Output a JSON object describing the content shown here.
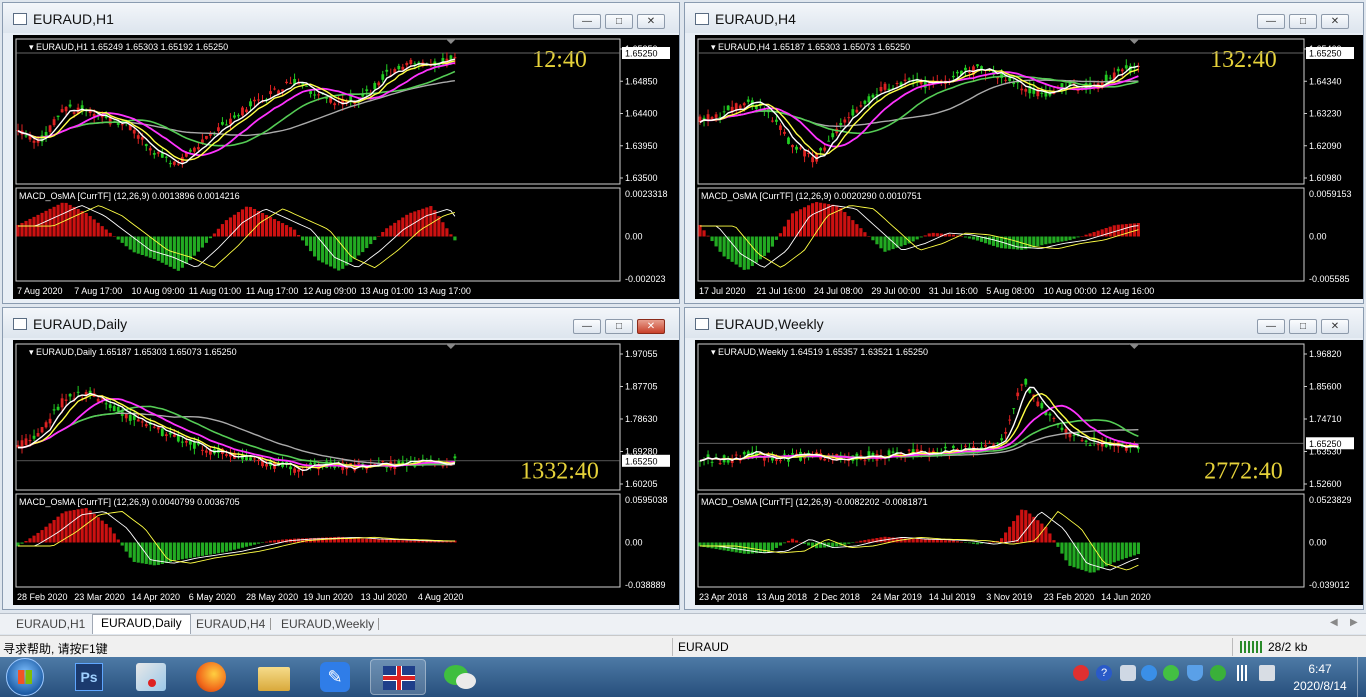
{
  "windows": [
    {
      "title": "EURAUD,H1",
      "info": "EURAUD,H1  1.65249 1.65303 1.65192 1.65250",
      "timer": "12:40",
      "price_ticks": [
        "1.65250",
        "1.64850",
        "1.64400",
        "1.63950",
        "1.63500"
      ],
      "price_current": "1.65250",
      "macd_label": "MACD_OsMA [CurrTF] (12,26,9) 0.0013896 0.0014216",
      "macd_ticks": [
        "0.0023318",
        "0.00",
        "-0.002023"
      ],
      "time_ticks": [
        "7 Aug 2020",
        "7 Aug 17:00",
        "10 Aug 09:00",
        "11 Aug 01:00",
        "11 Aug 17:00",
        "12 Aug 09:00",
        "13 Aug 01:00",
        "13 Aug 17:00"
      ],
      "close_style": "normal"
    },
    {
      "title": "EURAUD,H4",
      "info": "EURAUD,H4  1.65187 1.65303 1.65073 1.65250",
      "timer": "132:40",
      "price_ticks": [
        "1.65460",
        "1.64340",
        "1.63230",
        "1.62090",
        "1.60980"
      ],
      "price_current": "1.65250",
      "macd_label": "MACD_OsMA [CurrTF] (12,26,9) 0.0020290 0.0010751",
      "macd_ticks": [
        "0.0059153",
        "0.00",
        "-0.005585"
      ],
      "time_ticks": [
        "17 Jul 2020",
        "21 Jul 16:00",
        "24 Jul 08:00",
        "29 Jul 00:00",
        "31 Jul 16:00",
        "5 Aug 08:00",
        "10 Aug 00:00",
        "12 Aug 16:00"
      ],
      "close_style": "normal"
    },
    {
      "title": "EURAUD,Daily",
      "info": "EURAUD,Daily  1.65187 1.65303 1.65073 1.65250",
      "timer": "1332:40",
      "price_ticks": [
        "1.97055",
        "1.87705",
        "1.78630",
        "1.69280",
        "1.60205"
      ],
      "price_current": "1.65250",
      "macd_label": "MACD_OsMA [CurrTF] (12,26,9) 0.0040799 0.0036705",
      "macd_ticks": [
        "0.0595038",
        "0.00",
        "-0.038889"
      ],
      "time_ticks": [
        "28 Feb 2020",
        "23 Mar 2020",
        "14 Apr 2020",
        "6 May 2020",
        "28 May 2020",
        "19 Jun 2020",
        "13 Jul 2020",
        "4 Aug 2020"
      ],
      "close_style": "red"
    },
    {
      "title": "EURAUD,Weekly",
      "info": "EURAUD,Weekly  1.64519 1.65357 1.63521 1.65250",
      "timer": "2772:40",
      "price_ticks": [
        "1.96820",
        "1.85600",
        "1.74710",
        "1.63530",
        "1.52600"
      ],
      "price_current": "1.65250",
      "macd_label": "MACD_OsMA [CurrTF] (12,26,9) -0.0082202 -0.0081871",
      "macd_ticks": [
        "0.0523829",
        "0.00",
        "-0.039012"
      ],
      "time_ticks": [
        "23 Apr 2018",
        "13 Aug 2018",
        "2 Dec 2018",
        "24 Mar 2019",
        "14 Jul 2019",
        "3 Nov 2019",
        "23 Feb 2020",
        "14 Jun 2020"
      ],
      "close_style": "normal"
    }
  ],
  "tabs": [
    "EURAUD,H1",
    "EURAUD,Daily",
    "EURAUD,H4",
    "EURAUD,Weekly"
  ],
  "active_tab": "EURAUD,Daily",
  "status": {
    "help": "寻求帮助, 请按F1键",
    "symbol": "EURAUD",
    "traffic": "28/2 kb"
  },
  "clock": {
    "time": "6:47",
    "date": "2020/8/14"
  },
  "taskbar_apps": [
    "start",
    "photoshop",
    "paint",
    "firefox",
    "explorer",
    "docs",
    "flag",
    "wechat"
  ],
  "colors": {
    "timer": "#e6d23a",
    "bull_candle": "#22cc22",
    "bear_candle": "#dd2222",
    "ma_yellow": "#ffff44",
    "ma_white": "#ffffff",
    "ma_magenta": "#ff33ff",
    "ma_green": "#55cc55",
    "ma_gray": "#aaaaaa",
    "hist_pos": "#cc1111",
    "hist_neg": "#22aa22"
  }
}
